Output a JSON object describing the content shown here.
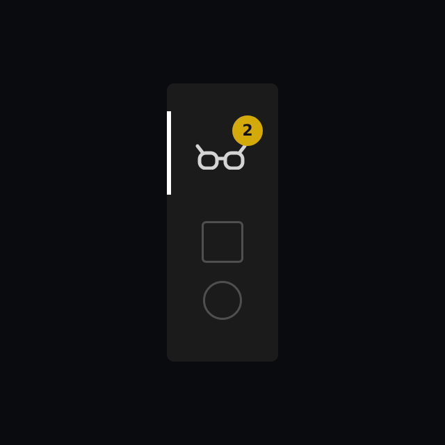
{
  "colors": {
    "background": "#090b0f",
    "panel": "#1b1b1b",
    "active_indicator": "#ffffff",
    "glasses_icon": "#d4d4d4",
    "badge_background": "#d4a90a",
    "badge_text": "#111111",
    "inactive_icon": "#4f4f4f"
  },
  "nav": {
    "items": [
      {
        "icon": "glasses-icon",
        "badge": "2",
        "active": true
      },
      {
        "icon": "square-icon",
        "active": false
      },
      {
        "icon": "circle-icon",
        "active": false
      }
    ]
  }
}
